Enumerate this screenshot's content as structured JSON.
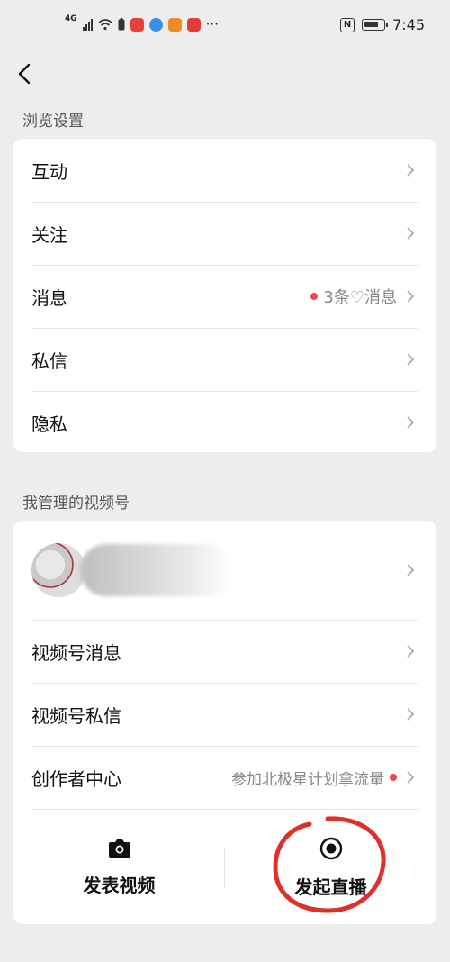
{
  "status_bar": {
    "network": "4G",
    "time": "7:45",
    "nfc": "N",
    "more": "···",
    "app_colors": [
      "#e8403c",
      "#3b8fe6",
      "#f08a24",
      "#e23b3b"
    ]
  },
  "nav": {
    "back_icon": "chevron-left-icon"
  },
  "browse": {
    "title": "浏览设置",
    "items": [
      {
        "label": "互动"
      },
      {
        "label": "关注"
      },
      {
        "label": "消息",
        "extra": "3条♡消息"
      },
      {
        "label": "私信"
      },
      {
        "label": "隐私"
      }
    ]
  },
  "channels": {
    "title": "我管理的视频号",
    "items": [
      {
        "label": "视频号消息"
      },
      {
        "label": "视频号私信"
      },
      {
        "label": "创作者中心",
        "extra": "参加北极星计划拿流量"
      }
    ],
    "actions": {
      "post_video": "发表视频",
      "start_live": "发起直播"
    }
  },
  "colors": {
    "accent_dot": "#f04848",
    "annotation": "#e0302a"
  }
}
